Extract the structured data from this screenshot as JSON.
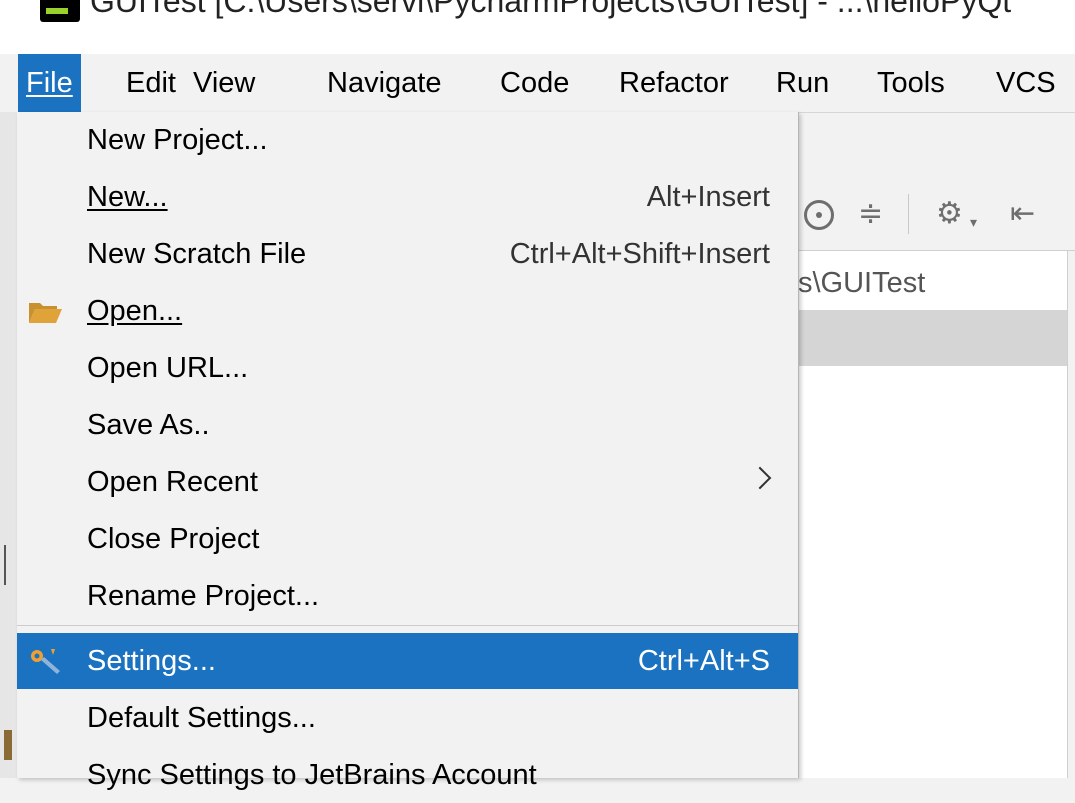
{
  "window": {
    "title": "GUITest [C:\\Users\\servi\\PycharmProjects\\GUITest] - ...\\helloPyQt"
  },
  "menubar": {
    "items": [
      {
        "label": "File"
      },
      {
        "label": "Edit"
      },
      {
        "label": "View"
      },
      {
        "label": "Navigate"
      },
      {
        "label": "Code"
      },
      {
        "label": "Refactor"
      },
      {
        "label": "Run"
      },
      {
        "label": "Tools"
      },
      {
        "label": "VCS"
      }
    ],
    "active": "File"
  },
  "file_menu": {
    "items": [
      {
        "label": "New Project..."
      },
      {
        "label": "New...",
        "shortcut": "Alt+Insert"
      },
      {
        "label": "New Scratch File",
        "shortcut": "Ctrl+Alt+Shift+Insert"
      },
      {
        "label": "Open...",
        "icon": "folder-open-icon"
      },
      {
        "label": "Open URL..."
      },
      {
        "label": "Save As.."
      },
      {
        "label": "Open Recent",
        "submenu": true
      },
      {
        "label": "Close Project"
      },
      {
        "label": "Rename Project..."
      },
      {
        "label": "Settings...",
        "shortcut": "Ctrl+Alt+S",
        "icon": "settings-wrench-icon",
        "highlighted": true
      },
      {
        "label": "Default Settings..."
      },
      {
        "label": "Sync Settings to JetBrains Account"
      }
    ]
  },
  "project_panel": {
    "path_fragment": "s\\GUITest"
  },
  "colors": {
    "highlight": "#1a72c0",
    "menu_bg": "#f2f2f2",
    "folder_icon": "#e0a33a"
  }
}
